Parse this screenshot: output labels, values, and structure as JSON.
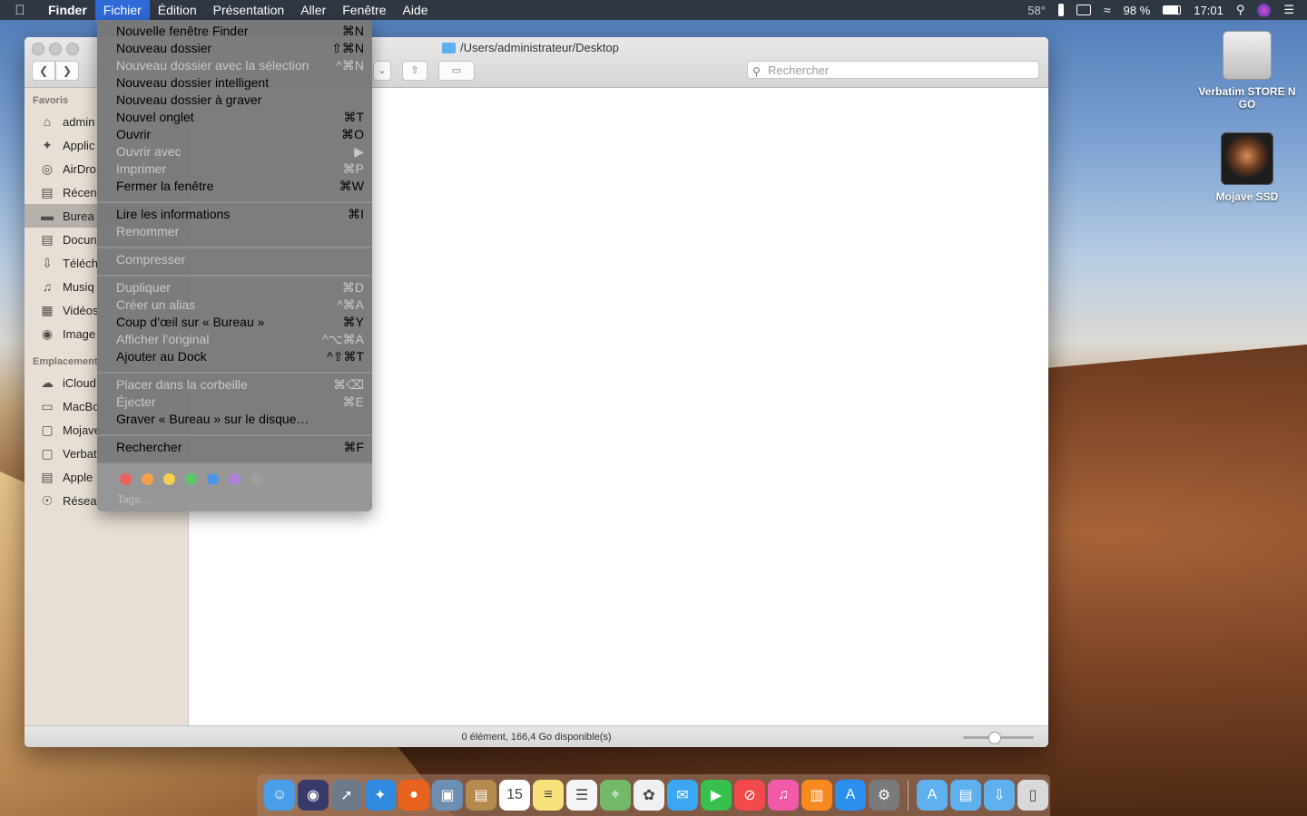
{
  "menubar": {
    "items": [
      "Finder",
      "Fichier",
      "Édition",
      "Présentation",
      "Aller",
      "Fenêtre",
      "Aide"
    ],
    "temperature": "58°",
    "battery": "98 %",
    "clock": "17:01"
  },
  "window": {
    "path": "/Users/administrateur/Desktop",
    "search_placeholder": "Rechercher",
    "status": "0 élément, 166,4 Go disponible(s)"
  },
  "sidebar": {
    "favorites_header": "Favoris",
    "favorites": [
      "admin",
      "Applic",
      "AirDro",
      "Récen",
      "Burea",
      "Docun",
      "Téléch",
      "Musiq",
      "Vidéos",
      "Image"
    ],
    "locations_header": "Emplacement",
    "locations": [
      "iCloud",
      "MacBo",
      "Mojave",
      "Verbat",
      "Apple",
      "Résea"
    ]
  },
  "menu": {
    "items": [
      {
        "label": "Nouvelle fenêtre Finder",
        "shortcut": "⌘N",
        "enabled": true
      },
      {
        "label": "Nouveau dossier",
        "shortcut": "⇧⌘N",
        "enabled": true
      },
      {
        "label": "Nouveau dossier avec la sélection",
        "shortcut": "^⌘N",
        "enabled": false
      },
      {
        "label": "Nouveau dossier intelligent",
        "shortcut": "",
        "enabled": true
      },
      {
        "label": "Nouveau dossier à graver",
        "shortcut": "",
        "enabled": true
      },
      {
        "label": "Nouvel onglet",
        "shortcut": "⌘T",
        "enabled": true
      },
      {
        "label": "Ouvrir",
        "shortcut": "⌘O",
        "enabled": true
      },
      {
        "label": "Ouvrir avec",
        "shortcut": "▶",
        "enabled": false
      },
      {
        "label": "Imprimer",
        "shortcut": "⌘P",
        "enabled": false
      },
      {
        "label": "Fermer la fenêtre",
        "shortcut": "⌘W",
        "enabled": true
      },
      {
        "label": "Lire les informations",
        "shortcut": "⌘I",
        "enabled": true
      },
      {
        "label": "Renommer",
        "shortcut": "",
        "enabled": false
      },
      {
        "label": "Compresser",
        "shortcut": "",
        "enabled": false
      },
      {
        "label": "Dupliquer",
        "shortcut": "⌘D",
        "enabled": false
      },
      {
        "label": "Créer un alias",
        "shortcut": "^⌘A",
        "enabled": false
      },
      {
        "label": "Coup d’œil sur « Bureau »",
        "shortcut": "⌘Y",
        "enabled": true
      },
      {
        "label": "Afficher l’original",
        "shortcut": "^⌥⌘A",
        "enabled": false
      },
      {
        "label": "Ajouter au Dock",
        "shortcut": "^⇧⌘T",
        "enabled": true
      },
      {
        "label": "Placer dans la corbeille",
        "shortcut": "⌘⌫",
        "enabled": false
      },
      {
        "label": "Éjecter",
        "shortcut": "⌘E",
        "enabled": false
      },
      {
        "label": "Graver « Bureau » sur le disque…",
        "shortcut": "",
        "enabled": true
      },
      {
        "label": "Rechercher",
        "shortcut": "⌘F",
        "enabled": true
      }
    ],
    "tags_label": "Tags…",
    "tag_colors": [
      "#ee5f5b",
      "#f6a24a",
      "#f3d04b",
      "#5dc667",
      "#4d94e8",
      "#b07fd9",
      "#9e9e9e"
    ]
  },
  "desktop": {
    "icons": [
      "Verbatim STORE N GO",
      "Mojave SSD"
    ]
  },
  "dock": {
    "apps": [
      {
        "name": "finder-icon",
        "color": "#4a9de8",
        "glyph": "☺"
      },
      {
        "name": "siri-icon",
        "color": "#3a3a6a",
        "glyph": "◉"
      },
      {
        "name": "launchpad-icon",
        "color": "#6d7a8a",
        "glyph": "➚"
      },
      {
        "name": "safari-icon",
        "color": "#2f8ae0",
        "glyph": "✦"
      },
      {
        "name": "firefox-icon",
        "color": "#e8631d",
        "glyph": "●"
      },
      {
        "name": "preview-icon",
        "color": "#6c8eb3",
        "glyph": "▣"
      },
      {
        "name": "contacts-icon",
        "color": "#b58a4f",
        "glyph": "▤"
      },
      {
        "name": "calendar-icon",
        "color": "#ffffff",
        "glyph": "15"
      },
      {
        "name": "notes-icon",
        "color": "#f7e27c",
        "glyph": "≡"
      },
      {
        "name": "reminders-icon",
        "color": "#f4f4f4",
        "glyph": "☰"
      },
      {
        "name": "maps-icon",
        "color": "#74b86a",
        "glyph": "⌖"
      },
      {
        "name": "photos-icon",
        "color": "#f0f0f0",
        "glyph": "✿"
      },
      {
        "name": "messages-icon",
        "color": "#3ba7f3",
        "glyph": "✉"
      },
      {
        "name": "facetime-icon",
        "color": "#37c14c",
        "glyph": "▶"
      },
      {
        "name": "news-icon",
        "color": "#f24a4a",
        "glyph": "⊘"
      },
      {
        "name": "itunes-icon",
        "color": "#f159a9",
        "glyph": "♫"
      },
      {
        "name": "books-icon",
        "color": "#f68a1e",
        "glyph": "▥"
      },
      {
        "name": "app-store-icon",
        "color": "#2b8ff0",
        "glyph": "A"
      },
      {
        "name": "system-preferences-icon",
        "color": "#7a7a7a",
        "glyph": "⚙"
      }
    ],
    "folders": [
      {
        "name": "applications-folder-icon",
        "color": "#5fb0ef",
        "glyph": "A"
      },
      {
        "name": "documents-folder-icon",
        "color": "#5fb0ef",
        "glyph": "▤"
      },
      {
        "name": "downloads-folder-icon",
        "color": "#5fb0ef",
        "glyph": "⇩"
      },
      {
        "name": "trash-icon",
        "color": "#d9d9d9",
        "glyph": "▯"
      }
    ]
  }
}
